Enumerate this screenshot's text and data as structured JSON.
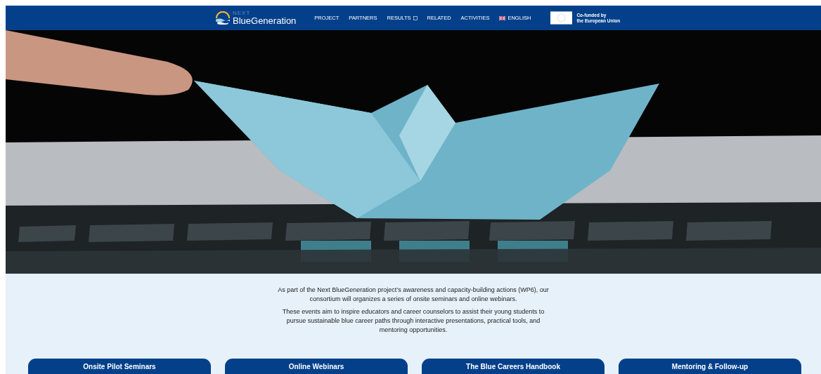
{
  "header": {
    "logo": {
      "small": "NEXT",
      "name": "BlueGeneration"
    },
    "nav": [
      {
        "label": "PROJECT",
        "kind": "link"
      },
      {
        "label": "PARTNERS",
        "kind": "link"
      },
      {
        "label": "RESULTS",
        "kind": "dropdown"
      },
      {
        "label": "RELATED",
        "kind": "link"
      },
      {
        "label": "ACTIVITIES",
        "kind": "link"
      },
      {
        "label": "ENGLISH",
        "kind": "language"
      }
    ],
    "funding": {
      "line1": "Co-funded by",
      "line2": "the European Union"
    }
  },
  "intro": {
    "paragraphs": [
      "As part of the Next BlueGeneration project’s awareness and capacity-building actions (WP6), our consortium will organizes a series of onsite seminars and online webinars.",
      "These events aim to inspire educators and career counselors to assist their young students to pursue sustainable blue career paths through interactive presentations, practical tools, and mentoring opportunities."
    ]
  },
  "buttons": [
    "Onsite Pilot Seminars",
    "Online Webinars",
    "The Blue Careers Handbook",
    "Mentoring & Follow-up"
  ]
}
